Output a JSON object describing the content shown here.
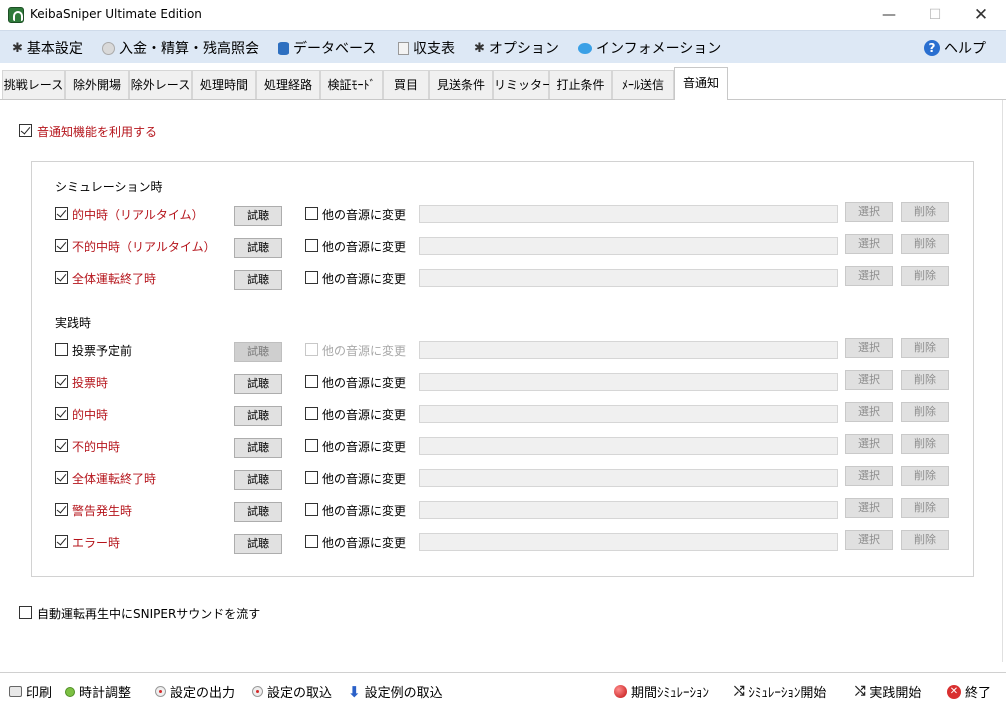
{
  "window": {
    "title": "KeibaSniper Ultimate Edition",
    "minimize": "—",
    "maximize": "☐",
    "close": "✕"
  },
  "menu": {
    "items": [
      {
        "label": "基本設定",
        "icon": "gear-icon"
      },
      {
        "label": "入金・精算・残高照会",
        "icon": "coin-icon"
      },
      {
        "label": "データベース",
        "icon": "database-icon"
      },
      {
        "label": "収支表",
        "icon": "document-icon"
      },
      {
        "label": "オプション",
        "icon": "gear-icon"
      },
      {
        "label": "インフォメーション",
        "icon": "chat-icon"
      },
      {
        "label": "ヘルプ",
        "icon": "help-icon"
      }
    ],
    "help_glyph": "?"
  },
  "tabs": [
    {
      "label": "挑戦レース"
    },
    {
      "label": "除外開場"
    },
    {
      "label": "除外レース"
    },
    {
      "label": "処理時間"
    },
    {
      "label": "処理経路"
    },
    {
      "label": "検証ﾓｰﾄﾞ"
    },
    {
      "label": "買目"
    },
    {
      "label": "見送条件"
    },
    {
      "label": "リミッター"
    },
    {
      "label": "打止条件"
    },
    {
      "label": "ﾒｰﾙ送信"
    },
    {
      "label": "音通知",
      "active": true
    }
  ],
  "sound": {
    "enable_label": "音通知機能を利用する",
    "enable_checked": true,
    "simulation_title": "シミュレーション時",
    "live_title": "実践時",
    "test_label": "試聴",
    "change_label": "他の音源に変更",
    "select_label": "選択",
    "delete_label": "削除",
    "simulation_rows": [
      {
        "label": "的中時（リアルタイム）",
        "checked": true,
        "enabled": true
      },
      {
        "label": "不的中時（リアルタイム）",
        "checked": true,
        "enabled": true
      },
      {
        "label": "全体運転終了時",
        "checked": true,
        "enabled": true
      }
    ],
    "live_rows": [
      {
        "label": "投票予定前",
        "checked": false,
        "enabled": false
      },
      {
        "label": "投票時",
        "checked": true,
        "enabled": true
      },
      {
        "label": "的中時",
        "checked": true,
        "enabled": true
      },
      {
        "label": "不的中時",
        "checked": true,
        "enabled": true
      },
      {
        "label": "全体運転終了時",
        "checked": true,
        "enabled": true
      },
      {
        "label": "警告発生時",
        "checked": true,
        "enabled": true
      },
      {
        "label": "エラー時",
        "checked": true,
        "enabled": true
      }
    ],
    "sniper_sound_label": "自動運転再生中にSNIPERサウンドを流す",
    "sniper_sound_checked": false
  },
  "bottom": {
    "items": [
      {
        "label": "印刷",
        "icon": "printer-icon"
      },
      {
        "label": "時計調整",
        "icon": "clock-icon"
      },
      {
        "label": "設定の出力",
        "icon": "export-icon"
      },
      {
        "label": "設定の取込",
        "icon": "import-icon"
      },
      {
        "label": "設定例の取込",
        "icon": "download-arrow-icon"
      },
      {
        "label": "期間ｼﾐｭﾚｰｼｮﾝ",
        "icon": "red-ball-icon"
      },
      {
        "label": "ｼﾐｭﾚｰｼｮﾝ開始",
        "icon": "shuffle-icon"
      },
      {
        "label": "実践開始",
        "icon": "shuffle-icon"
      },
      {
        "label": "終了",
        "icon": "close-circle-icon"
      }
    ],
    "shuffle_glyph": "⤭",
    "arrow_glyph": "⬇",
    "close_glyph": "✕"
  }
}
